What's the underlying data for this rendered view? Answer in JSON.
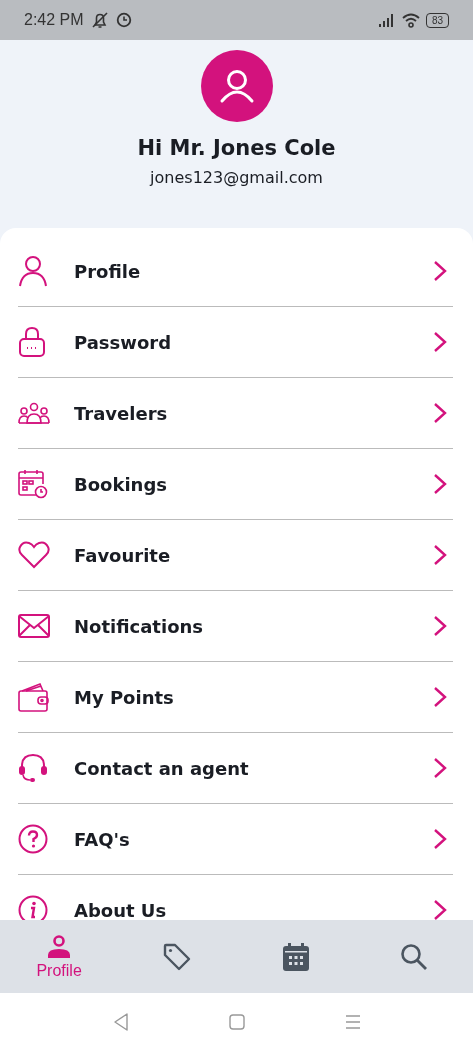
{
  "status_bar": {
    "time": "2:42 PM",
    "battery": "83"
  },
  "header": {
    "greeting": "Hi Mr. Jones Cole",
    "email": "jones123@gmail.com"
  },
  "menu": [
    {
      "label": "Profile"
    },
    {
      "label": "Password"
    },
    {
      "label": "Travelers"
    },
    {
      "label": "Bookings"
    },
    {
      "label": "Favourite"
    },
    {
      "label": "Notifications"
    },
    {
      "label": "My Points"
    },
    {
      "label": "Contact an agent"
    },
    {
      "label": "FAQ's"
    },
    {
      "label": "About Us"
    }
  ],
  "bottom_nav": [
    {
      "label": "Profile",
      "selected": true
    },
    {
      "selected": false
    },
    {
      "selected": false
    },
    {
      "selected": false
    }
  ]
}
